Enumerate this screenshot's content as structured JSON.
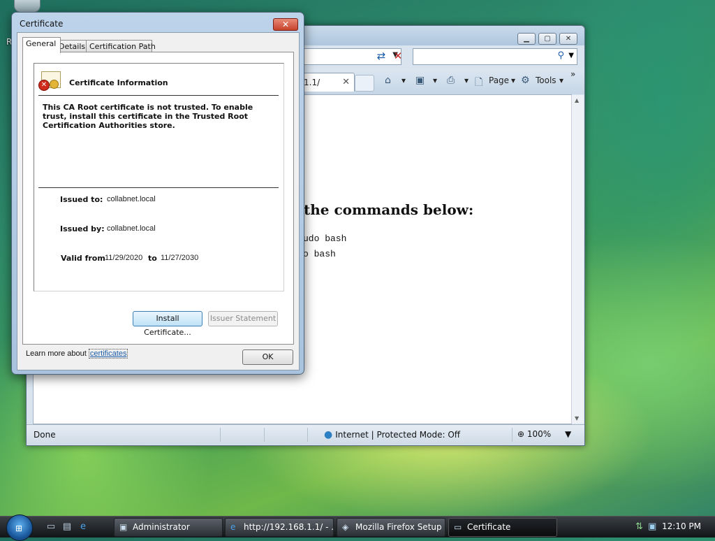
{
  "desktop": {
    "edge_letter": "R"
  },
  "ie": {
    "tab_title": "1.1/",
    "toolbar": {
      "page_label": "Page",
      "tools_label": "Tools"
    },
    "content": {
      "heading": "the commands below:",
      "code_lines": [
        "udo bash",
        "o bash"
      ]
    },
    "status": {
      "done": "Done",
      "zone": "Internet | Protected Mode: Off",
      "zoom": "100%"
    }
  },
  "cert": {
    "title": "Certificate",
    "tabs": [
      "General",
      "Details",
      "Certification Path"
    ],
    "info_title": "Certificate Information",
    "warning": "This CA Root certificate is not trusted. To enable trust, install this certificate in the Trusted Root Certification Authorities store.",
    "issued_to_label": "Issued to:",
    "issued_to": "collabnet.local",
    "issued_by_label": "Issued by:",
    "issued_by": "collabnet.local",
    "valid_from_label": "Valid from",
    "valid_from": "11/29/2020",
    "to_label": "to",
    "valid_to": "11/27/2030",
    "install_button": "Install Certificate...",
    "issuer_button": "Issuer Statement",
    "learn_prefix": "Learn more about",
    "learn_link": "certificates",
    "ok_button": "OK"
  },
  "taskbar": {
    "tasks": [
      "Administrator",
      "http://192.168.1.1/ - ...",
      "Mozilla Firefox Setup",
      "Certificate"
    ],
    "clock": "12:10 PM"
  }
}
